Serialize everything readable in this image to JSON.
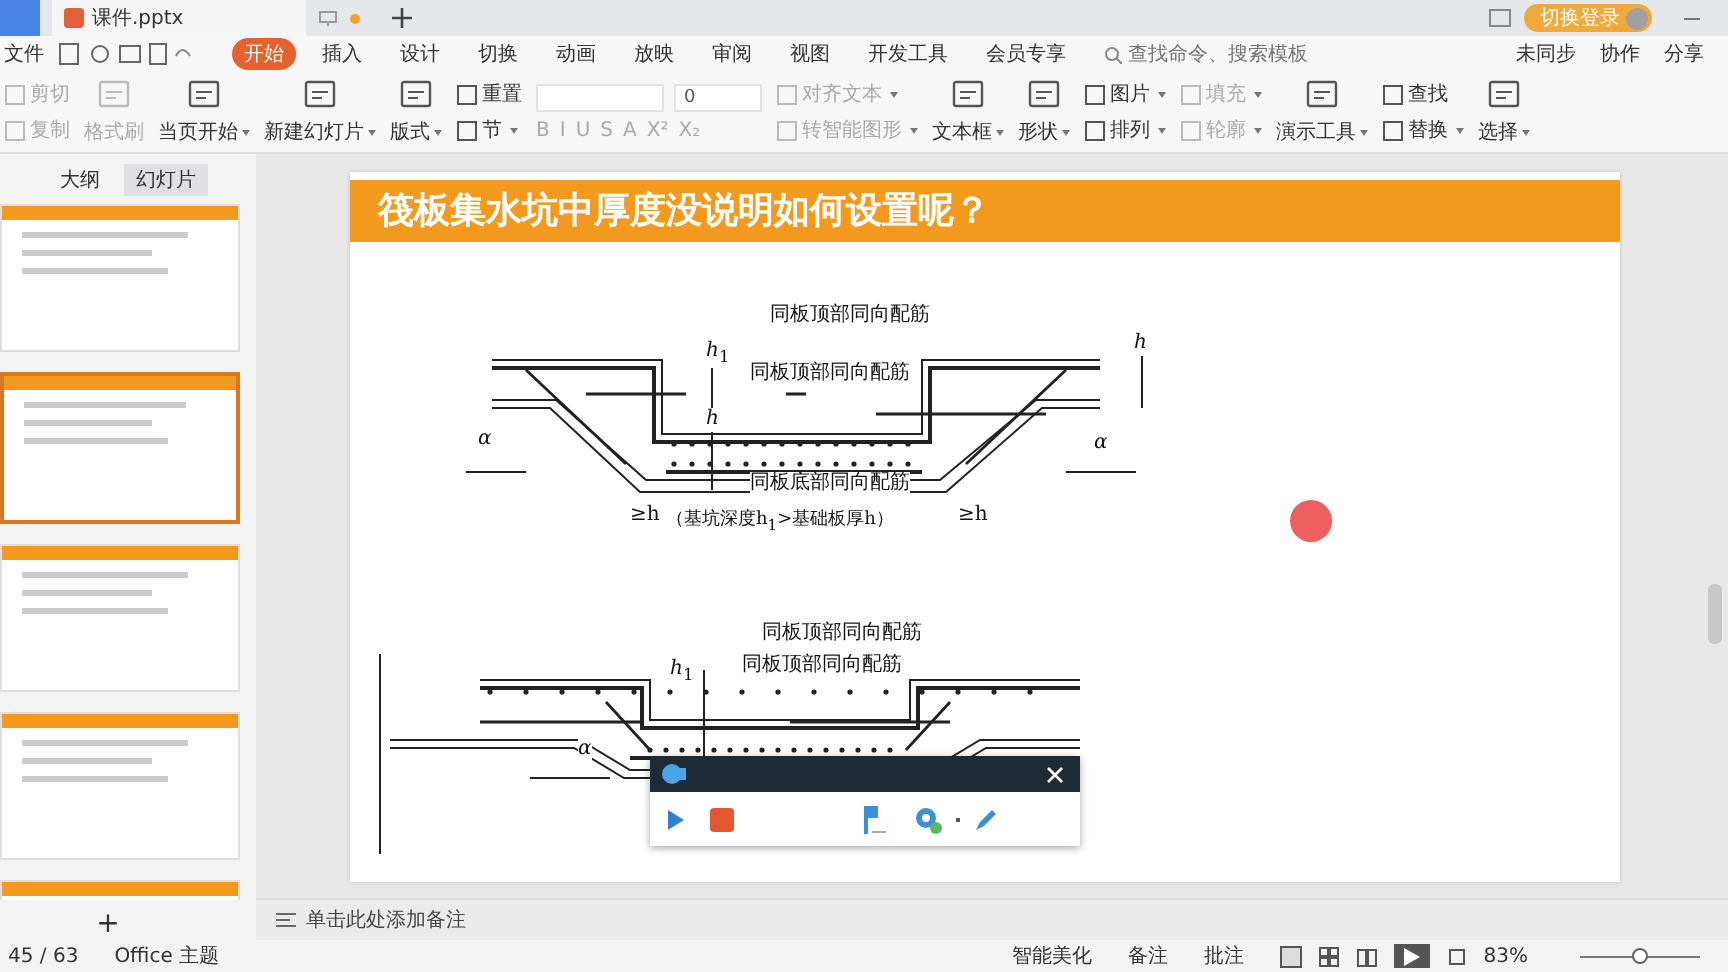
{
  "title_bar": {
    "tabs": [
      {
        "label": "课件.pptx",
        "selected": true
      }
    ],
    "login_button": "切换登录"
  },
  "menu": {
    "file": "文件",
    "tabs": [
      {
        "label": "开始",
        "selected": true
      },
      {
        "label": "插入",
        "selected": false
      },
      {
        "label": "设计",
        "selected": false
      },
      {
        "label": "切换",
        "selected": false
      },
      {
        "label": "动画",
        "selected": false
      },
      {
        "label": "放映",
        "selected": false
      },
      {
        "label": "审阅",
        "selected": false
      },
      {
        "label": "视图",
        "selected": false
      },
      {
        "label": "开发工具",
        "selected": false
      },
      {
        "label": "会员专享",
        "selected": false
      }
    ],
    "search": {
      "placeholder": "查找命令、搜索模板"
    },
    "actions": [
      "未同步",
      "协作",
      "分享"
    ]
  },
  "ribbon": [
    {
      "kind": "stack",
      "items": [
        {
          "label": "剪切",
          "disabled": true,
          "caret": false
        },
        {
          "label": "复制",
          "disabled": true,
          "caret": false
        }
      ]
    },
    {
      "kind": "large",
      "label": "格式刷",
      "disabled": true,
      "caret": false
    },
    {
      "kind": "large",
      "label": "当页开始",
      "disabled": false,
      "caret": true
    },
    {
      "kind": "large",
      "label": "新建幻灯片",
      "disabled": false,
      "caret": true
    },
    {
      "kind": "large",
      "label": "版式",
      "disabled": false,
      "caret": true
    },
    {
      "kind": "stack",
      "items": [
        {
          "label": "重置",
          "disabled": false,
          "caret": false
        },
        {
          "label": "节",
          "disabled": false,
          "caret": true
        }
      ]
    },
    {
      "kind": "font",
      "size": "0",
      "buttons": [
        "B",
        "I",
        "U",
        "S",
        "A",
        "X²",
        "X₂"
      ]
    },
    {
      "kind": "stack",
      "items": [
        {
          "label": "对齐文本",
          "disabled": true,
          "caret": true
        },
        {
          "label": "转智能图形",
          "disabled": true,
          "caret": true
        }
      ]
    },
    {
      "kind": "large",
      "label": "文本框",
      "disabled": false,
      "caret": true
    },
    {
      "kind": "large",
      "label": "形状",
      "disabled": false,
      "caret": true
    },
    {
      "kind": "stack",
      "items": [
        {
          "label": "图片",
          "disabled": false,
          "caret": true
        },
        {
          "label": "排列",
          "disabled": false,
          "caret": true
        }
      ]
    },
    {
      "kind": "stack",
      "items": [
        {
          "label": "填充",
          "disabled": true,
          "caret": true
        },
        {
          "label": "轮廓",
          "disabled": true,
          "caret": true
        }
      ]
    },
    {
      "kind": "large",
      "label": "演示工具",
      "disabled": false,
      "caret": true
    },
    {
      "kind": "stack",
      "items": [
        {
          "label": "查找",
          "disabled": false,
          "caret": false
        },
        {
          "label": "替换",
          "disabled": false,
          "caret": true
        }
      ]
    },
    {
      "kind": "large",
      "label": "选择",
      "disabled": false,
      "caret": true
    }
  ],
  "panel": {
    "tabs": [
      {
        "label": "大纲",
        "selected": false
      },
      {
        "label": "幻灯片",
        "selected": true
      }
    ],
    "slides": [
      {
        "selected": false
      },
      {
        "selected": true
      },
      {
        "selected": false
      },
      {
        "selected": false
      },
      {
        "selected": false
      }
    ],
    "add_button": "+"
  },
  "slide": {
    "title": "筏板集水坑中厚度没说明如何设置呢？",
    "diagram_1": [
      "同板顶部同向配筋",
      "同板顶部同向配筋",
      "同板底部同向配筋",
      "*h*$_{1}$",
      "*h*",
      "*h*",
      "*α*",
      "*α*",
      "≥h",
      "（基坑深度h$_{1}$>基础板厚h）",
      "≥h"
    ],
    "diagram_2": [
      "同板顶部同向配筋",
      "*h*$_{1}$",
      "同板顶部同向配筋",
      "*α*"
    ],
    "pointer": {
      "color": "#ef5f5f"
    }
  },
  "recorder": {
    "visible": true
  },
  "notes": {
    "placeholder": "单击此处添加备注"
  },
  "status_bar": {
    "slide_count": "45 / 63",
    "theme": "Office 主题",
    "beautify": "智能美化",
    "notes": "备注",
    "comments": "批注",
    "zoom": "83%",
    "zoom_level": {
      "level": 0.5
    }
  }
}
